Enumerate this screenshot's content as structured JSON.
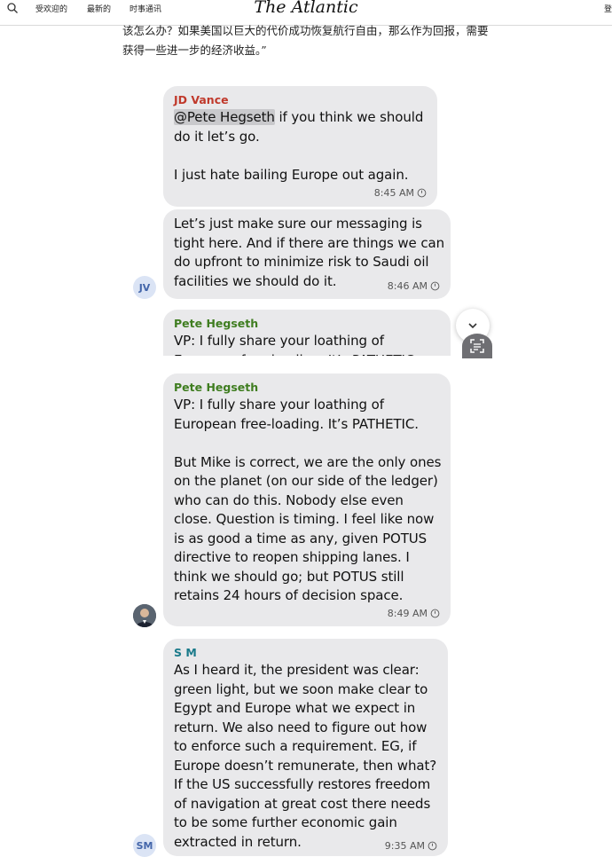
{
  "nav": {
    "links": [
      "受欢迎的",
      "最新的",
      "时事通讯"
    ],
    "brand": "The Atlantic",
    "edge": "登"
  },
  "intro": {
    "text": "该怎么办？如果美国以巨大的代价成功恢复航行自由，那么作为回报，需要获得一些进一步的经济收益。”"
  },
  "chat": [
    {
      "sender": "JD Vance",
      "sender_color": "#c0392b",
      "mention": "@Pete Hegseth",
      "text": " if you think we should\ndo it let’s go.\n\nI just hate bailing Europe out again.",
      "time": "8:45 AM"
    },
    {
      "text": "Let’s just make sure our messaging is\ntight here. And if there are things we can\ndo upfront to minimize risk to Saudi oil\nfacilities we should do it.",
      "time": "8:46 AM",
      "avatar": "JV"
    },
    {
      "sender": "Pete Hegseth",
      "sender_color": "#3f7d20",
      "text": "VP: I fully share your loathing of\nEuropean free-loading. It’s PATHETIC.",
      "clipped": true
    },
    {
      "sender": "Pete Hegseth",
      "sender_color": "#3f7d20",
      "text": "VP: I fully share your loathing of\nEuropean free-loading. It’s PATHETIC.\n\nBut Mike is correct, we are the only ones\non the planet (on our side of the ledger)\nwho can do this. Nobody else even\nclose. Question is timing. I feel like now\nis as good a time as any, given POTUS\ndirective to reopen shipping lanes. I\nthink we should go; but POTUS still\nretains 24 hours of decision space.",
      "time": "8:49 AM"
    },
    {
      "sender": "S M",
      "sender_color": "#1a7a8a",
      "text": "As I heard it, the president was clear:\ngreen light, but we soon make clear to\nEgypt and Europe what we expect in\nreturn. We also need to figure out how\nto enforce such a requirement. EG, if\nEurope doesn’t remunerate, then what?\nIf the US successfully restores freedom\nof navigation at great cost there needs\nto be some further economic gain\nextracted in return.",
      "time": "9:35 AM",
      "avatar": "SM"
    }
  ],
  "icons": {
    "search": "search-icon",
    "clock": "clock-icon",
    "scroll_down": "chevron-down-icon",
    "scan": "scan-text-icon"
  }
}
